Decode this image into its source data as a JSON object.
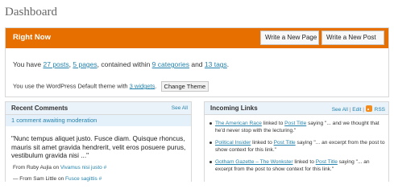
{
  "page": {
    "title": "Dashboard"
  },
  "right_now": {
    "title": "Right Now",
    "write_page_label": "Write a New Page",
    "write_post_label": "Write a New Post",
    "line1": {
      "prefix": "You have ",
      "posts": "27 posts",
      "sep1": ", ",
      "pages": "5 pages",
      "mid": ", contained within ",
      "categories": "9 categories",
      "and": " and ",
      "tags": "13 tags",
      "end": "."
    },
    "line2": {
      "prefix": "You use the WordPress Default theme with ",
      "widgets": "3 widgets",
      "end": ".",
      "change_theme_label": "Change Theme"
    }
  },
  "recent_comments": {
    "title": "Recent Comments",
    "see_all": "See All",
    "moderation": "1 comment awaiting moderation",
    "quote": "\"Nunc tempus aliquet justo. Fusce diam. Quisque rhoncus, mauris sit amet gravida hendrerit, velit eros posuere purus, vestibulum gravida nisi ...\"",
    "item1": {
      "prefix": "From Ruby Aujla on ",
      "link": "Vivamus nisi justo #"
    },
    "item2": {
      "prefix": "— From Sam Little on ",
      "link": "Fusce sagittis #"
    }
  },
  "incoming_links": {
    "title": "Incoming Links",
    "see_all": "See All",
    "edit": "Edit",
    "rss": "RSS",
    "items": [
      {
        "source": "The American Race",
        "linked": " linked to ",
        "post": "Post Title",
        "text": " saying \"... and we thought that he'd never stop with the lecturing.\""
      },
      {
        "source": "Political Insider",
        "linked": " linked to ",
        "post": "Post Title",
        "text": " saying \"... an excerpt from the post to show context for this link.\""
      },
      {
        "source": "Gotham Gazette – The Wonkster",
        "linked": " linked to ",
        "post": "Post Title",
        "text": " saying \"... an excerpt from the post to show context for this link.\""
      }
    ]
  }
}
